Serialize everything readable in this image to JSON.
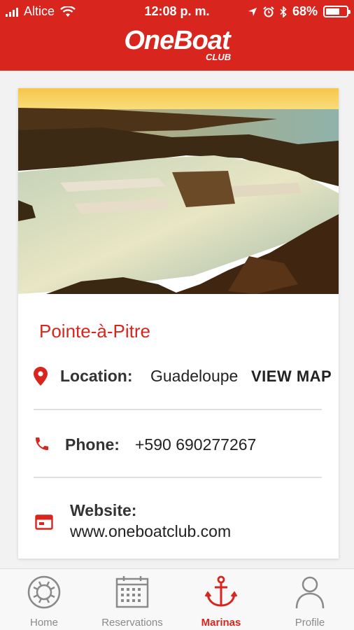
{
  "status_bar": {
    "carrier": "Altice",
    "time": "12:08 p. m.",
    "battery": "68%",
    "battery_level": 0.68
  },
  "header": {
    "logo_main": "OneBoat",
    "logo_sub": "CLUB"
  },
  "marina": {
    "name": "Pointe-à-Pitre",
    "location_label": "Location:",
    "location_value": "Guadeloupe",
    "view_map": "VIEW MAP",
    "phone_label": "Phone:",
    "phone_value": "+590 690277267",
    "website_label": "Website:",
    "website_value": "www.oneboatclub.com"
  },
  "nav": {
    "items": [
      {
        "label": "Home",
        "icon": "lifebuoy-icon"
      },
      {
        "label": "Reservations",
        "icon": "calendar-icon"
      },
      {
        "label": "Marinas",
        "icon": "anchor-icon",
        "active": true
      },
      {
        "label": "Profile",
        "icon": "person-icon"
      }
    ]
  },
  "colors": {
    "brand": "#d8261f",
    "inactive": "#8a8a8a"
  }
}
